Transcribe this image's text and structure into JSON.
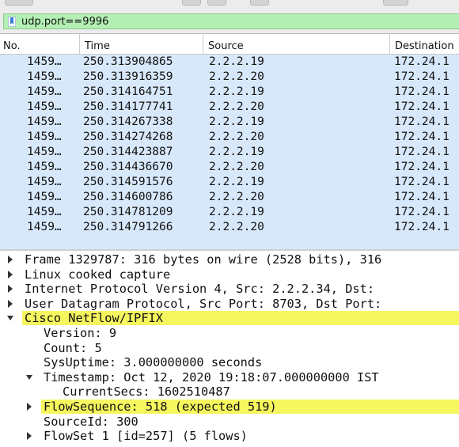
{
  "filter": {
    "value": "udp.port==9996",
    "icon": "bookmark-icon"
  },
  "packet_list": {
    "columns": [
      "No.",
      "Time",
      "Source",
      "Destination"
    ],
    "rows": [
      {
        "no": "1459…",
        "time": "250.313904865",
        "source": "2.2.2.19",
        "destination": "172.24.1"
      },
      {
        "no": "1459…",
        "time": "250.313916359",
        "source": "2.2.2.20",
        "destination": "172.24.1"
      },
      {
        "no": "1459…",
        "time": "250.314164751",
        "source": "2.2.2.19",
        "destination": "172.24.1"
      },
      {
        "no": "1459…",
        "time": "250.314177741",
        "source": "2.2.2.20",
        "destination": "172.24.1"
      },
      {
        "no": "1459…",
        "time": "250.314267338",
        "source": "2.2.2.19",
        "destination": "172.24.1"
      },
      {
        "no": "1459…",
        "time": "250.314274268",
        "source": "2.2.2.20",
        "destination": "172.24.1"
      },
      {
        "no": "1459…",
        "time": "250.314423887",
        "source": "2.2.2.19",
        "destination": "172.24.1"
      },
      {
        "no": "1459…",
        "time": "250.314436670",
        "source": "2.2.2.20",
        "destination": "172.24.1"
      },
      {
        "no": "1459…",
        "time": "250.314591576",
        "source": "2.2.2.19",
        "destination": "172.24.1"
      },
      {
        "no": "1459…",
        "time": "250.314600786",
        "source": "2.2.2.20",
        "destination": "172.24.1"
      },
      {
        "no": "1459…",
        "time": "250.314781209",
        "source": "2.2.2.19",
        "destination": "172.24.1"
      },
      {
        "no": "1459…",
        "time": "250.314791266",
        "source": "2.2.2.20",
        "destination": "172.24.1"
      }
    ],
    "row_color": "#d8e8fb"
  },
  "details": {
    "highlight_color": "#f6f65e",
    "rows": [
      {
        "text": "Frame 1329787: 316 bytes on wire (2528 bits), 316",
        "expander": "collapsed",
        "highlight": false
      },
      {
        "text": "Linux cooked capture",
        "expander": "collapsed",
        "highlight": false
      },
      {
        "text": "Internet Protocol Version 4, Src: 2.2.2.34, Dst:",
        "expander": "collapsed",
        "highlight": false
      },
      {
        "text": "User Datagram Protocol, Src Port: 8703, Dst Port:",
        "expander": "collapsed",
        "highlight": false
      },
      {
        "text": "Cisco NetFlow/IPFIX",
        "expander": "expanded",
        "highlight": true
      },
      {
        "text": "Version: 9",
        "expander": "none",
        "highlight": false
      },
      {
        "text": "Count: 5",
        "expander": "none",
        "highlight": false
      },
      {
        "text": "SysUptime: 3.000000000 seconds",
        "expander": "none",
        "highlight": false
      },
      {
        "text": "Timestamp: Oct 12, 2020 19:18:07.000000000 IST",
        "expander": "expanded",
        "highlight": false
      },
      {
        "text": "CurrentSecs: 1602510487",
        "expander": "none",
        "highlight": false
      },
      {
        "text": "FlowSequence: 518 (expected 519)",
        "expander": "collapsed",
        "highlight": true
      },
      {
        "text": "SourceId: 300",
        "expander": "none",
        "highlight": false
      },
      {
        "text": "FlowSet 1 [id=257] (5 flows)",
        "expander": "collapsed",
        "highlight": false
      }
    ]
  }
}
